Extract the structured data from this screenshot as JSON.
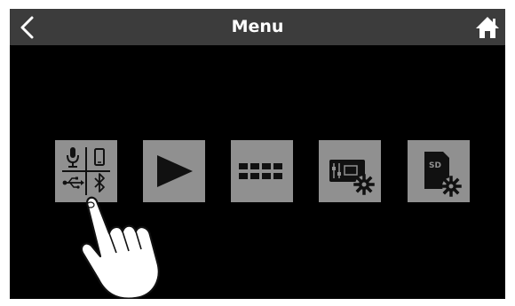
{
  "header": {
    "title": "Menu",
    "back_icon": "chevron-left-icon",
    "home_icon": "home-icon"
  },
  "menu": {
    "items": [
      {
        "icon": "input-sources-icon"
      },
      {
        "icon": "play-icon"
      },
      {
        "icon": "grid-icon"
      },
      {
        "icon": "mixer-settings-icon"
      },
      {
        "icon": "sd-card-settings-icon"
      }
    ]
  },
  "overlay": {
    "icon": "pointing-hand-icon"
  },
  "colors": {
    "topbar": "#3c3c3c",
    "background": "#000000",
    "tile": "#909090",
    "icon": "#111111"
  }
}
